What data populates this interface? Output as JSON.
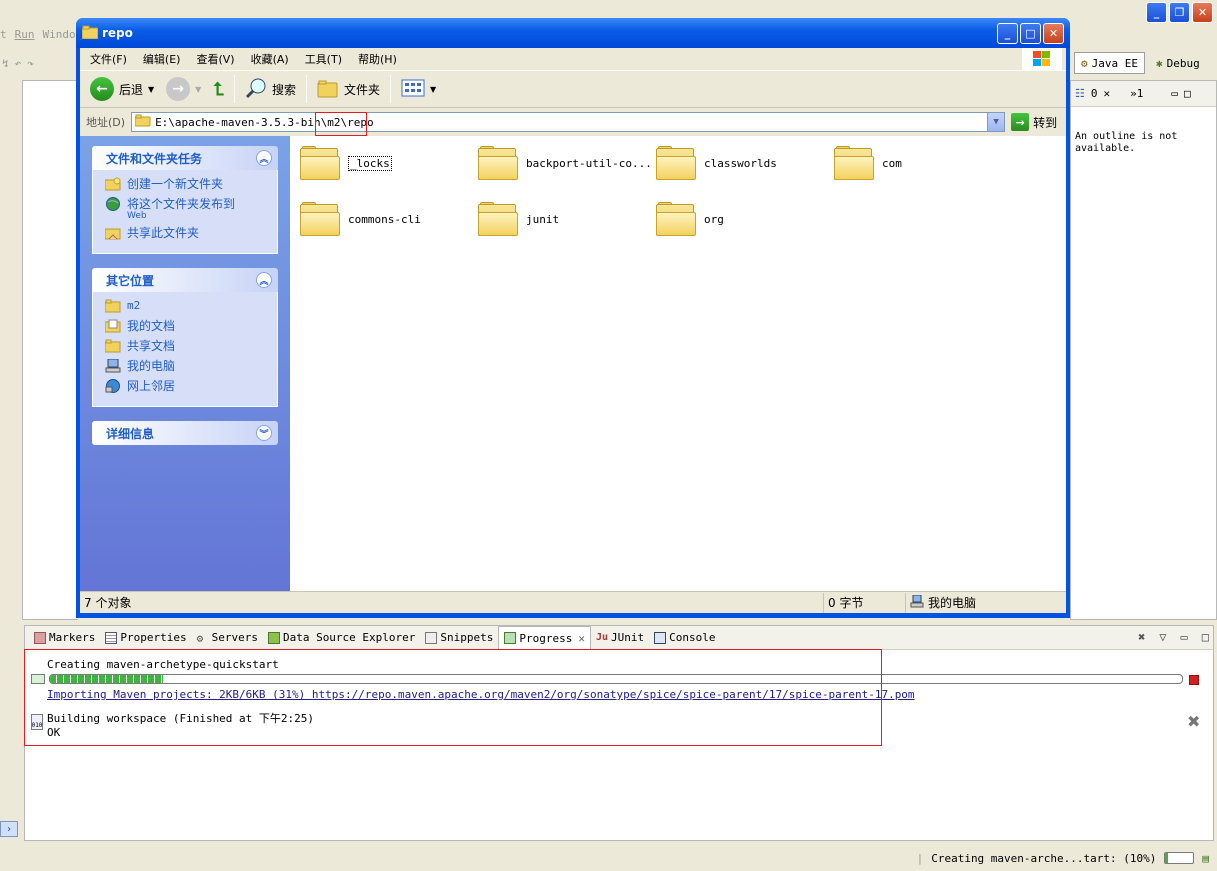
{
  "eclipse": {
    "menu": [
      "t",
      "Run",
      "Windo"
    ],
    "perspectives": [
      {
        "label": "Java EE",
        "icon": "java-ee-perspective-icon"
      },
      {
        "label": "Debug",
        "icon": "debug-bug-icon"
      }
    ],
    "outline_tab": "0",
    "outline_overflow": "»1",
    "outline_message": "An outline is not available.",
    "status_text": "Creating maven-arche...tart: (10%)",
    "status_progress": 0.1
  },
  "explorer": {
    "title": "repo",
    "menu": [
      "文件(F)",
      "编辑(E)",
      "查看(V)",
      "收藏(A)",
      "工具(T)",
      "帮助(H)"
    ],
    "toolbar": {
      "back": "后退",
      "search": "搜索",
      "folders": "文件夹"
    },
    "address_label": "地址(D)",
    "address_value": "E:\\apache-maven-3.5.3-bin\\m2\\repo",
    "go_label": "转到",
    "task_groups": [
      {
        "title": "文件和文件夹任务",
        "items": [
          {
            "label": "创建一个新文件夹",
            "sub": "",
            "icon": "new-folder-icon"
          },
          {
            "label": "将这个文件夹发布到",
            "sub": "Web",
            "icon": "publish-web-icon"
          },
          {
            "label": "共享此文件夹",
            "sub": "",
            "icon": "share-folder-icon"
          }
        ]
      },
      {
        "title": "其它位置",
        "items": [
          {
            "label": "m2",
            "sub": "",
            "icon": "folder-icon"
          },
          {
            "label": "我的文档",
            "sub": "",
            "icon": "my-documents-icon"
          },
          {
            "label": "共享文档",
            "sub": "",
            "icon": "shared-documents-icon"
          },
          {
            "label": "我的电脑",
            "sub": "",
            "icon": "my-computer-icon"
          },
          {
            "label": "网上邻居",
            "sub": "",
            "icon": "network-places-icon"
          }
        ]
      },
      {
        "title": "详细信息",
        "items": []
      }
    ],
    "folders": [
      "_locks",
      "backport-util-co...",
      "classworlds",
      "com",
      "commons-cli",
      "junit",
      "org"
    ],
    "status": {
      "objects": "7 个对象",
      "size": "0 字节",
      "location": "我的电脑"
    }
  },
  "bottom": {
    "tabs": [
      "Markers",
      "Properties",
      "Servers",
      "Data Source Explorer",
      "Snippets",
      "Progress",
      "JUnit",
      "Console"
    ],
    "active_tab": "Progress",
    "progress_title": "Creating maven-archetype-quickstart",
    "progress_value": 0.1,
    "progress_detail": "Importing Maven projects: 2KB/6KB (31%) https://repo.maven.apache.org/maven2/org/sonatype/spice/spice-parent/17/spice-parent-17.pom",
    "job2_title": "Building workspace (Finished at 下午2:25)",
    "job2_status": "OK"
  },
  "colors": {
    "xp_blue": "#0054e3",
    "highlight_red": "#e02020",
    "progress_green": "#3fb53f"
  }
}
